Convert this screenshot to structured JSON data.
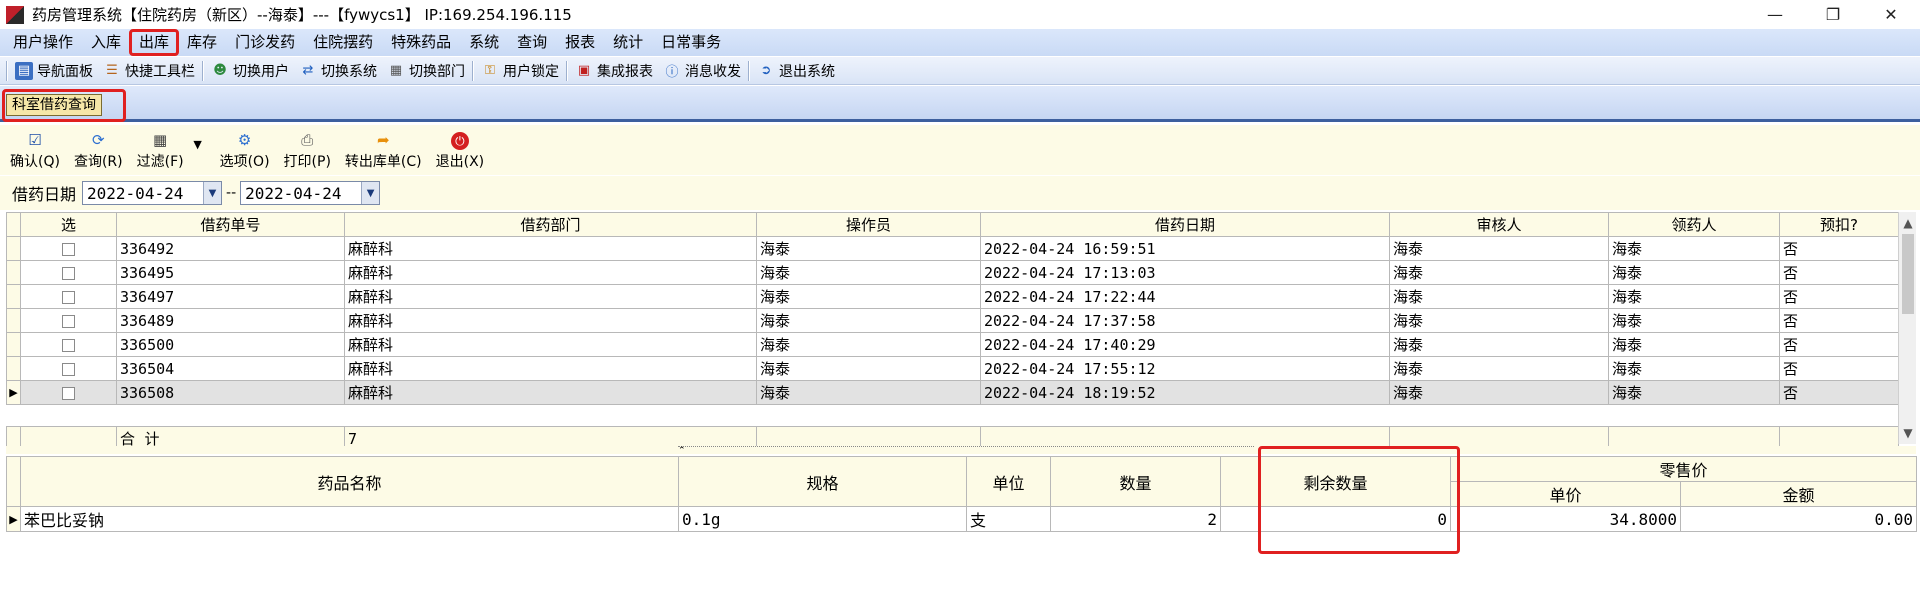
{
  "window": {
    "title": "药房管理系统【住院药房（新区）--海泰】---【fywycs1】 IP:169.254.196.115",
    "controls": [
      "minimize",
      "restore",
      "close"
    ]
  },
  "menu": [
    {
      "label": "用户操作"
    },
    {
      "label": "入库"
    },
    {
      "label": "出库",
      "highlighted": true
    },
    {
      "label": "库存"
    },
    {
      "label": "门诊发药"
    },
    {
      "label": "住院摆药"
    },
    {
      "label": "特殊药品"
    },
    {
      "label": "系统"
    },
    {
      "label": "查询"
    },
    {
      "label": "报表"
    },
    {
      "label": "统计"
    },
    {
      "label": "日常事务"
    }
  ],
  "toolbar": [
    {
      "label": "导航面板",
      "icon": "navigation-panel-icon"
    },
    {
      "label": "快捷工具栏",
      "icon": "quick-toolbar-icon"
    },
    {
      "label": "切换用户",
      "icon": "switch-user-icon"
    },
    {
      "label": "切换系统",
      "icon": "switch-system-icon"
    },
    {
      "label": "切换部门",
      "icon": "switch-department-icon"
    },
    {
      "label": "用户锁定",
      "icon": "user-lock-icon"
    },
    {
      "label": "集成报表",
      "icon": "integrated-report-icon"
    },
    {
      "label": "消息收发",
      "icon": "message-icon"
    },
    {
      "label": "退出系统",
      "icon": "exit-system-icon"
    }
  ],
  "tab": {
    "label": "科室借药查询",
    "highlighted": true
  },
  "actions": [
    {
      "label": "确认(Q)",
      "icon": "confirm-icon"
    },
    {
      "label": "查询(R)",
      "icon": "refresh-icon"
    },
    {
      "label": "过滤(F)",
      "icon": "filter-icon"
    },
    {
      "label": "选项(O)",
      "icon": "options-icon"
    },
    {
      "label": "打印(P)",
      "icon": "print-icon"
    },
    {
      "label": "转出库单(C)",
      "icon": "transfer-icon"
    },
    {
      "label": "退出(X)",
      "icon": "exit-icon"
    }
  ],
  "filter": {
    "label": "借药日期",
    "from": "2022-04-24",
    "separator": "--",
    "to": "2022-04-24"
  },
  "grid": {
    "columns": [
      "选",
      "借药单号",
      "借药部门",
      "操作员",
      "借药日期",
      "审核人",
      "领药人",
      "预扣?"
    ],
    "rows": [
      {
        "id": "336492",
        "dept": "麻醉科",
        "operator": "海泰",
        "date": "2022-04-24 16:59:51",
        "reviewer": "海泰",
        "receiver": "海泰",
        "withheld": "否"
      },
      {
        "id": "336495",
        "dept": "麻醉科",
        "operator": "海泰",
        "date": "2022-04-24 17:13:03",
        "reviewer": "海泰",
        "receiver": "海泰",
        "withheld": "否"
      },
      {
        "id": "336497",
        "dept": "麻醉科",
        "operator": "海泰",
        "date": "2022-04-24 17:22:44",
        "reviewer": "海泰",
        "receiver": "海泰",
        "withheld": "否"
      },
      {
        "id": "336489",
        "dept": "麻醉科",
        "operator": "海泰",
        "date": "2022-04-24 17:37:58",
        "reviewer": "海泰",
        "receiver": "海泰",
        "withheld": "否"
      },
      {
        "id": "336500",
        "dept": "麻醉科",
        "operator": "海泰",
        "date": "2022-04-24 17:40:29",
        "reviewer": "海泰",
        "receiver": "海泰",
        "withheld": "否"
      },
      {
        "id": "336504",
        "dept": "麻醉科",
        "operator": "海泰",
        "date": "2022-04-24 17:55:12",
        "reviewer": "海泰",
        "receiver": "海泰",
        "withheld": "否"
      },
      {
        "id": "336508",
        "dept": "麻醉科",
        "operator": "海泰",
        "date": "2022-04-24 18:19:52",
        "reviewer": "海泰",
        "receiver": "海泰",
        "withheld": "否",
        "selected": true
      }
    ],
    "total_label": "合  计",
    "total_value": "7"
  },
  "detail": {
    "columns": {
      "name": "药品名称",
      "spec": "规格",
      "unit": "单位",
      "qty": "数量",
      "remaining": "剩余数量",
      "retail_group": "零售价",
      "unit_price": "单价",
      "amount": "金额"
    },
    "rows": [
      {
        "name": "苯巴比妥钠",
        "spec": "0.1g",
        "unit": "支",
        "qty": "2",
        "remaining": "0",
        "unit_price": "34.8000",
        "amount": "0.00"
      }
    ]
  },
  "colors": {
    "highlight": "#e02020",
    "panel_bg": "#fdfbe6",
    "menubar_bg": "#c9daf5",
    "tab_bg": "#f6e7a8"
  }
}
